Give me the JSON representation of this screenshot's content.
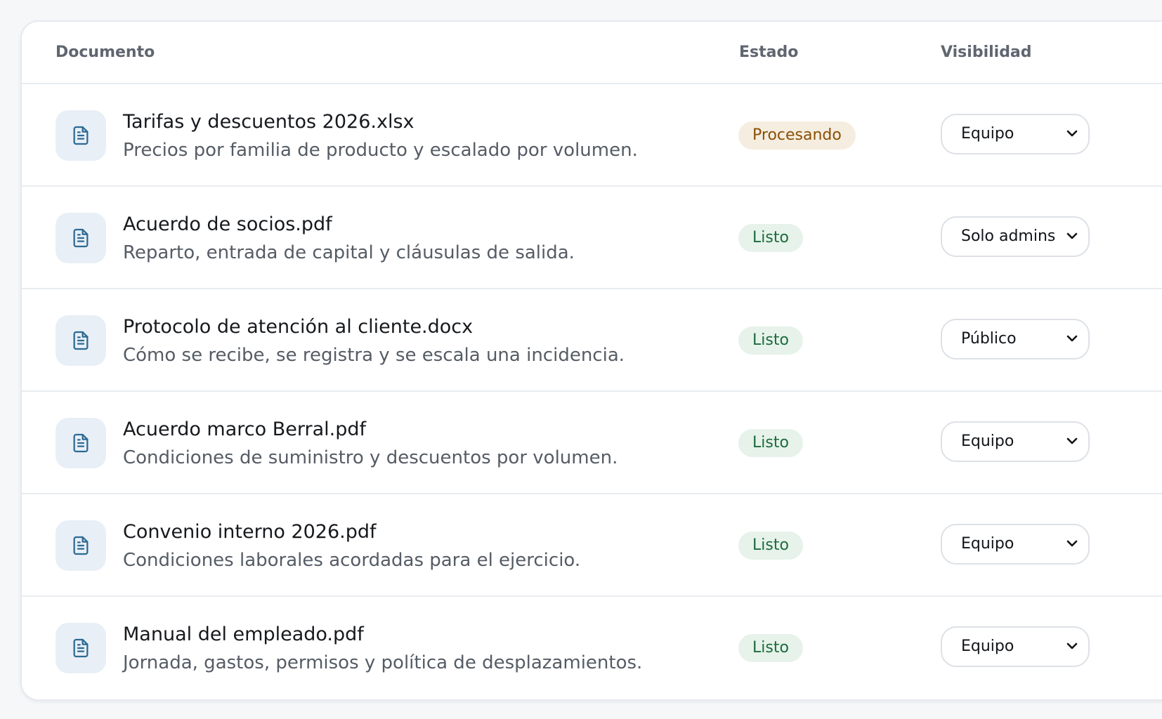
{
  "table": {
    "headers": {
      "document": "Documento",
      "status": "Estado",
      "visibility": "Visibilidad"
    },
    "rows": [
      {
        "name": "Tarifas y descuentos 2026.xlsx",
        "description": "Precios por familia de producto y escalado por volumen.",
        "status": "Procesando",
        "status_kind": "processing",
        "visibility": "Equipo"
      },
      {
        "name": "Acuerdo de socios.pdf",
        "description": "Reparto, entrada de capital y cláusulas de salida.",
        "status": "Listo",
        "status_kind": "ready",
        "visibility": "Solo admins"
      },
      {
        "name": "Protocolo de atención al cliente.docx",
        "description": "Cómo se recibe, se registra y se escala una incidencia.",
        "status": "Listo",
        "status_kind": "ready",
        "visibility": "Público"
      },
      {
        "name": "Acuerdo marco Berral.pdf",
        "description": "Condiciones de suministro y descuentos por volumen.",
        "status": "Listo",
        "status_kind": "ready",
        "visibility": "Equipo"
      },
      {
        "name": "Convenio interno 2026.pdf",
        "description": "Condiciones laborales acordadas para el ejercicio.",
        "status": "Listo",
        "status_kind": "ready",
        "visibility": "Equipo"
      },
      {
        "name": "Manual del empleado.pdf",
        "description": "Jornada, gastos, permisos y política de desplazamientos.",
        "status": "Listo",
        "status_kind": "ready",
        "visibility": "Equipo"
      }
    ]
  },
  "icons": {
    "file": "document-icon",
    "dropdown": "chevron-down-icon"
  },
  "colors": {
    "processing_bg": "#f5ede0",
    "processing_text": "#8a4f06",
    "ready_bg": "#e6f2ea",
    "ready_text": "#1c6b3c",
    "icon_tile": "#e8eff6",
    "icon_stroke": "#2c6a93"
  }
}
